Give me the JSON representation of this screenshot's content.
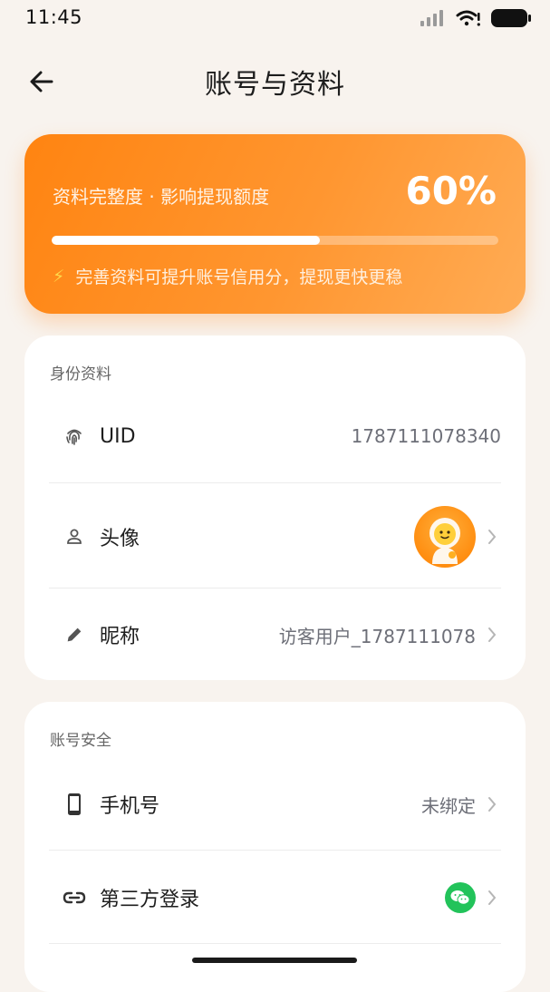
{
  "status_bar": {
    "time": "11:45"
  },
  "nav": {
    "title": "账号与资料"
  },
  "completeness": {
    "label": "资料完整度 · 影响提现额度",
    "value_text": "60%",
    "fraction": 0.6,
    "hint": "完善资料可提升账号信用分，提现更快更稳"
  },
  "identity": {
    "title": "身份资料",
    "uid": {
      "label": "UID",
      "value": "1787111078340"
    },
    "avatar": {
      "label": "头像"
    },
    "nickname": {
      "label": "昵称",
      "value": "访客用户_1787111078"
    }
  },
  "security": {
    "title": "账号安全",
    "phone": {
      "label": "手机号",
      "value": "未绑定"
    },
    "third_party": {
      "label": "第三方登录"
    }
  },
  "colors": {
    "accent": "#ff8a1a",
    "background": "#f8f3ee",
    "wechat": "#22c35a"
  },
  "icons": {
    "uid": "fingerprint-icon",
    "avatar": "person-icon",
    "nickname": "pencil-icon",
    "phone": "phone-icon",
    "third_party": "link-icon"
  }
}
